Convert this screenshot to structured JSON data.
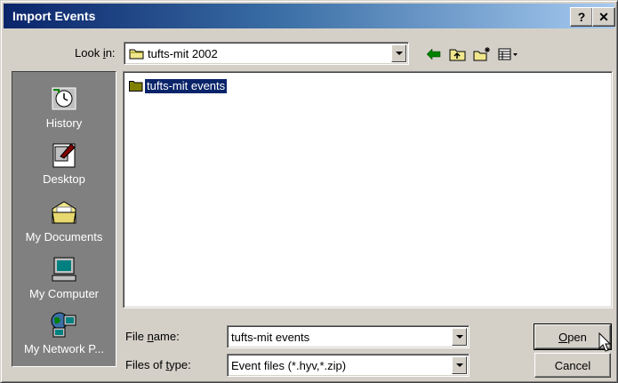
{
  "window": {
    "title": "Import Events",
    "help_label": "?",
    "close_label": "✕"
  },
  "look_in": {
    "label_pre": "Look ",
    "label_u": "i",
    "label_post": "n:",
    "value": "tufts-mit 2002"
  },
  "toolbar": {
    "icons": [
      "back-arrow-icon",
      "up-folder-icon",
      "new-folder-icon",
      "view-menu-icon"
    ]
  },
  "places": [
    {
      "label": "History",
      "icon": "history-icon"
    },
    {
      "label": "Desktop",
      "icon": "desktop-icon"
    },
    {
      "label": "My Documents",
      "icon": "my-documents-icon"
    },
    {
      "label": "My Computer",
      "icon": "my-computer-icon"
    },
    {
      "label": "My Network P...",
      "icon": "network-places-icon"
    }
  ],
  "files": [
    {
      "name": "tufts-mit events",
      "selected": true
    }
  ],
  "file_name": {
    "label_pre": "File ",
    "label_u": "n",
    "label_post": "ame:",
    "value": "tufts-mit events"
  },
  "file_type": {
    "label_pre": "Files of ",
    "label_u": "t",
    "label_post": "ype:",
    "value": "Event files (*.hyv,*.zip)"
  },
  "buttons": {
    "open_u": "O",
    "open_rest": "pen",
    "cancel": "Cancel"
  },
  "colors": {
    "titlebar_start": "#0a246a",
    "titlebar_end": "#a6caf0",
    "selection": "#0a246a",
    "face": "#d4d0c8"
  }
}
